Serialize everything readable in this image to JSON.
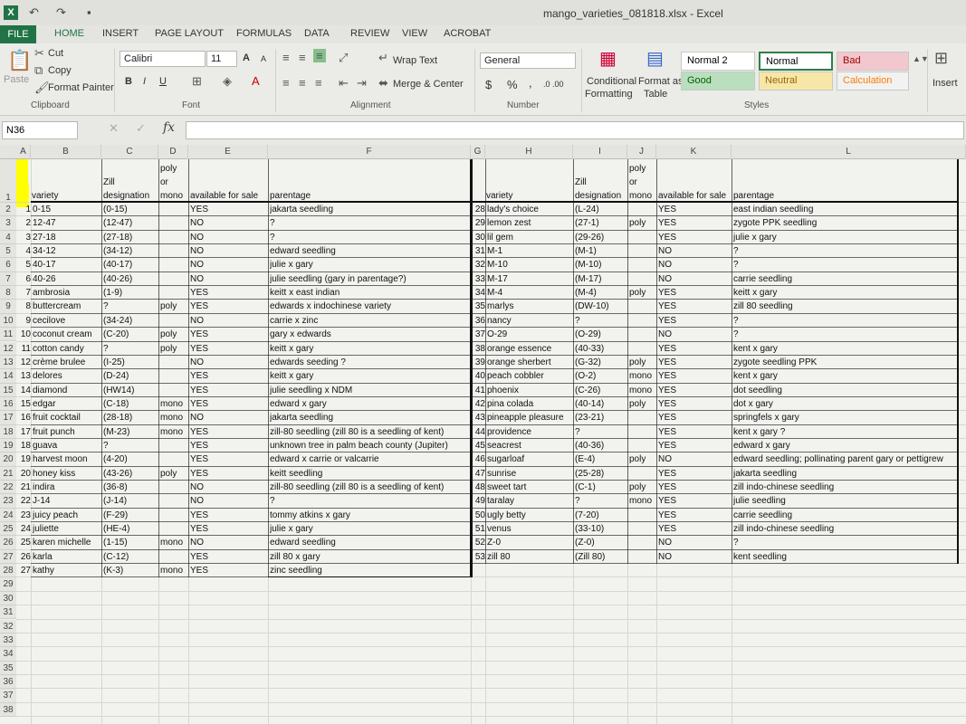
{
  "window": {
    "title": "mango_varieties_081818.xlsx - Excel",
    "app_letter": "X"
  },
  "tabs": [
    "FILE",
    "HOME",
    "INSERT",
    "PAGE LAYOUT",
    "FORMULAS",
    "DATA",
    "REVIEW",
    "VIEW",
    "ACROBAT"
  ],
  "ribbon": {
    "clipboard": {
      "paste": "Paste",
      "cut": "Cut",
      "copy": "Copy",
      "format_painter": "Format Painter",
      "label": "Clipboard"
    },
    "font": {
      "name": "Calibri",
      "size": "11",
      "bold": "B",
      "italic": "I",
      "underline": "U",
      "grow": "A",
      "shrink": "A",
      "label": "Font"
    },
    "alignment": {
      "wrap": "Wrap Text",
      "merge": "Merge & Center",
      "label": "Alignment"
    },
    "number": {
      "format": "General",
      "currency": "$",
      "percent": "%",
      "comma": ",",
      "inc": ".0 .00",
      "label": "Number"
    },
    "cond_format": {
      "line1": "Conditional",
      "line2": "Formatting"
    },
    "format_table": {
      "line1": "Format as",
      "line2": "Table"
    },
    "styles": {
      "normal2": "Normal 2",
      "normal": "Normal",
      "bad": "Bad",
      "good": "Good",
      "neutral": "Neutral",
      "calculation": "Calculation",
      "label": "Styles"
    },
    "insert": "Insert"
  },
  "formula_bar": {
    "name_box": "N36",
    "fx": "fx",
    "value": ""
  },
  "columns": [
    "A",
    "B",
    "C",
    "D",
    "E",
    "F",
    "G",
    "H",
    "I",
    "J",
    "K",
    "L"
  ],
  "header_left": {
    "B": "variety",
    "C1": "Zill",
    "C2": "designation",
    "D1": "poly",
    "D2": "or",
    "D3": "mono",
    "E": "available for sale",
    "F": "parentage"
  },
  "header_right": {
    "H": "variety",
    "I1": "Zill",
    "I2": "designation",
    "J1": "poly",
    "J2": "or",
    "J3": "mono",
    "K": "available for sale",
    "L": "parentage"
  },
  "left_rows": [
    [
      "1",
      "0-15",
      "(0-15)",
      "",
      "YES",
      "jakarta seedling"
    ],
    [
      "2",
      "12-47",
      "(12-47)",
      "",
      "NO",
      "?"
    ],
    [
      "3",
      "27-18",
      "(27-18)",
      "",
      "NO",
      "?"
    ],
    [
      "4",
      "34-12",
      "(34-12)",
      "",
      "NO",
      "edward seedling"
    ],
    [
      "5",
      "40-17",
      "(40-17)",
      "",
      "NO",
      "julie x gary"
    ],
    [
      "6",
      "40-26",
      "(40-26)",
      "",
      "NO",
      "julie seedling (gary in parentage?)"
    ],
    [
      "7",
      "ambrosia",
      "(1-9)",
      "",
      "YES",
      "keitt x east indian"
    ],
    [
      "8",
      "buttercream",
      "?",
      "poly",
      "YES",
      "edwards x indochinese variety"
    ],
    [
      "9",
      "cecilove",
      "(34-24)",
      "",
      "NO",
      "carrie x zinc"
    ],
    [
      "10",
      "coconut cream",
      "(C-20)",
      "poly",
      "YES",
      "gary x edwards"
    ],
    [
      "11",
      "cotton candy",
      "?",
      "poly",
      "YES",
      "keitt x gary"
    ],
    [
      "12",
      "crème brulee",
      "(I-25)",
      "",
      "NO",
      "edwards seeding ?"
    ],
    [
      "13",
      "delores",
      "(D-24)",
      "",
      "YES",
      "keitt x gary"
    ],
    [
      "14",
      "diamond",
      "(HW14)",
      "",
      "YES",
      "julie seedling x NDM"
    ],
    [
      "15",
      "edgar",
      "(C-18)",
      "mono",
      "YES",
      "edward x gary"
    ],
    [
      "16",
      "fruit cocktail",
      "(28-18)",
      "mono",
      "NO",
      "jakarta seedling"
    ],
    [
      "17",
      "fruit punch",
      "(M-23)",
      "mono",
      "YES",
      "zill-80 seedling (zill 80 is a seedling of kent)"
    ],
    [
      "18",
      "guava",
      "?",
      "",
      "YES",
      "unknown tree in palm beach county (Jupiter)"
    ],
    [
      "19",
      "harvest moon",
      "(4-20)",
      "",
      "YES",
      "edward x carrie or valcarrie"
    ],
    [
      "20",
      "honey kiss",
      "(43-26)",
      "poly",
      "YES",
      "keitt seedling"
    ],
    [
      "21",
      "indira",
      "(36-8)",
      "",
      "NO",
      "zill-80 seedling (zill 80 is a seedling of kent)"
    ],
    [
      "22",
      "J-14",
      "(J-14)",
      "",
      "NO",
      "?"
    ],
    [
      "23",
      "juicy peach",
      "(F-29)",
      "",
      "YES",
      "tommy atkins x gary"
    ],
    [
      "24",
      "juliette",
      "(HE-4)",
      "",
      "YES",
      "julie x gary"
    ],
    [
      "25",
      "karen michelle",
      "(1-15)",
      "mono",
      "NO",
      "edward seedling"
    ],
    [
      "26",
      "karla",
      "(C-12)",
      "",
      "YES",
      "zill 80 x gary"
    ],
    [
      "27",
      "kathy",
      "(K-3)",
      "mono",
      "YES",
      "zinc seedling"
    ]
  ],
  "right_rows": [
    [
      "28",
      "lady's choice",
      "(L-24)",
      "",
      "YES",
      "east indian seedling"
    ],
    [
      "29",
      "lemon zest",
      "(27-1)",
      "poly",
      "YES",
      "zygote PPK seedling"
    ],
    [
      "30",
      "lil gem",
      "(29-26)",
      "",
      "YES",
      "julie x gary"
    ],
    [
      "31",
      "M-1",
      "(M-1)",
      "",
      "NO",
      "?"
    ],
    [
      "32",
      "M-10",
      "(M-10)",
      "",
      "NO",
      "?"
    ],
    [
      "33",
      "M-17",
      "(M-17)",
      "",
      "NO",
      "carrie seedling"
    ],
    [
      "34",
      "M-4",
      "(M-4)",
      "poly",
      "YES",
      "keitt x gary"
    ],
    [
      "35",
      "marlys",
      "(DW-10)",
      "",
      "YES",
      "zill 80 seedling"
    ],
    [
      "36",
      "nancy",
      "?",
      "",
      "YES",
      "?"
    ],
    [
      "37",
      "O-29",
      "(O-29)",
      "",
      "NO",
      "?"
    ],
    [
      "38",
      "orange essence",
      "(40-33)",
      "",
      "YES",
      "kent x gary"
    ],
    [
      "39",
      "orange sherbert",
      "(G-32)",
      "poly",
      "YES",
      "zygote seedling PPK"
    ],
    [
      "40",
      "peach cobbler",
      "(O-2)",
      "mono",
      "YES",
      "kent x gary"
    ],
    [
      "41",
      "phoenix",
      "(C-26)",
      "mono",
      "YES",
      "dot seedling"
    ],
    [
      "42",
      "pina colada",
      "(40-14)",
      "poly",
      "YES",
      "dot x gary"
    ],
    [
      "43",
      "pineapple pleasure",
      "(23-21)",
      "",
      "YES",
      "springfels x gary"
    ],
    [
      "44",
      "providence",
      "?",
      "",
      "YES",
      "kent x gary ?"
    ],
    [
      "45",
      "seacrest",
      "(40-36)",
      "",
      "YES",
      "edward x gary"
    ],
    [
      "46",
      "sugarloaf",
      "(E-4)",
      "poly",
      "NO",
      "edward seedling; pollinating parent gary or pettigrew"
    ],
    [
      "47",
      "sunrise",
      "(25-28)",
      "",
      "YES",
      "jakarta seedling"
    ],
    [
      "48",
      "sweet tart",
      "(C-1)",
      "poly",
      "YES",
      "zill indo-chinese seedling"
    ],
    [
      "49",
      "taralay",
      "?",
      "mono",
      "YES",
      "julie seedling"
    ],
    [
      "50",
      "ugly betty",
      "(7-20)",
      "",
      "YES",
      "carrie seedling"
    ],
    [
      "51",
      "venus",
      "(33-10)",
      "",
      "YES",
      "zill indo-chinese seedling"
    ],
    [
      "52",
      "Z-0",
      "(Z-0)",
      "",
      "NO",
      "?"
    ],
    [
      "53",
      "zill 80",
      "(Zill 80)",
      "",
      "NO",
      "kent seedling"
    ]
  ],
  "highlights": {
    "left": [
      7,
      24
    ],
    "right": [
      6,
      13
    ],
    "color": "#ffff00"
  },
  "row_numbers": [
    "1",
    "2",
    "3",
    "4",
    "5",
    "6",
    "7",
    "8",
    "9",
    "10",
    "11",
    "12",
    "13",
    "14",
    "15",
    "16",
    "17",
    "18",
    "19",
    "20",
    "21",
    "22",
    "23",
    "24",
    "25",
    "26",
    "27",
    "28",
    "29",
    "30",
    "31",
    "32",
    "33",
    "34",
    "35",
    "36",
    "37",
    "38"
  ]
}
